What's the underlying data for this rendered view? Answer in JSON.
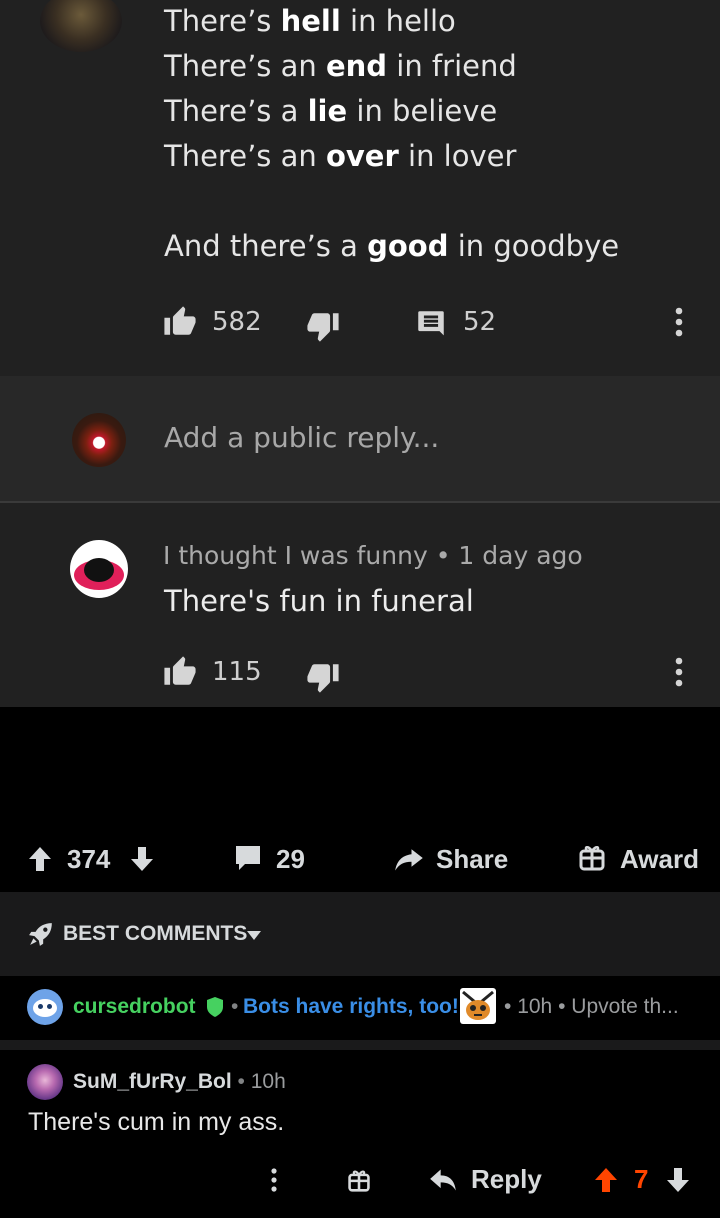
{
  "youtube": {
    "comment_lines": [
      {
        "pre": "There’s ",
        "bold": "hell",
        "post": " in hello"
      },
      {
        "pre": "There’s an ",
        "bold": "end",
        "post": " in friend"
      },
      {
        "pre": "There’s a ",
        "bold": "lie",
        "post": " in believe"
      },
      {
        "pre": "There’s an ",
        "bold": "over",
        "post": " in lover"
      },
      {
        "pre": "And there’s a ",
        "bold": "good",
        "post": " in goodbye"
      }
    ],
    "likes": "582",
    "replies": "52",
    "reply_placeholder": "Add a public reply...",
    "reply": {
      "author": "I thought I was funny",
      "time": "1 day ago",
      "separator": "•",
      "text": "There's fun in funeral",
      "likes": "115"
    }
  },
  "reddit": {
    "post_actions": {
      "upvotes": "374",
      "comments": "29",
      "share": "Share",
      "award": "Award"
    },
    "sort_label": "BEST COMMENTS",
    "bot_comment": {
      "author": "cursedrobot",
      "flair": "Bots have rights, too!",
      "time": "10h",
      "preview": "Upvote th...",
      "separator": "•"
    },
    "user_comment": {
      "author": "SuM_fUrRy_Bol",
      "time": "10h",
      "separator": "•",
      "text": "There's cum in my ass.",
      "reply_label": "Reply",
      "score": "7"
    },
    "colors": {
      "upvote_active": "#ff4500",
      "bot_name": "#46d160",
      "flair_blue": "#3a8ee6"
    }
  }
}
